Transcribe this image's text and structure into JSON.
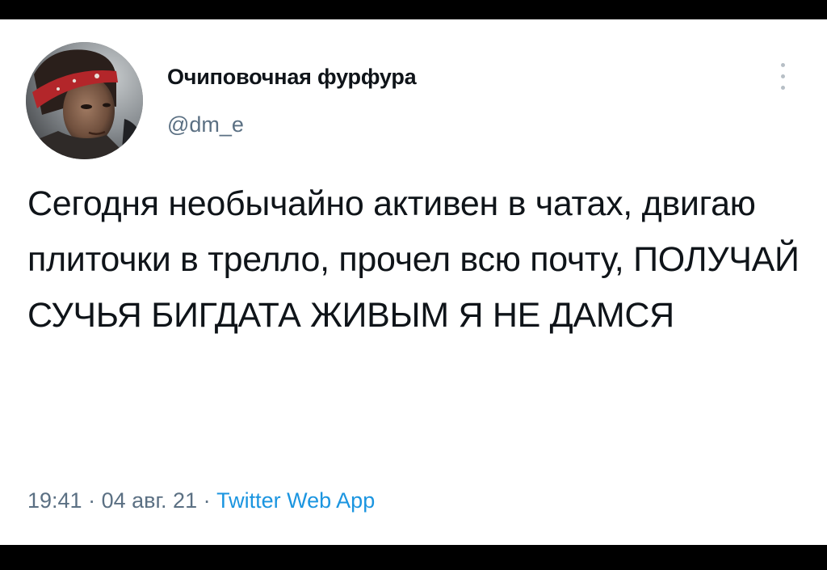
{
  "tweet": {
    "author": {
      "name": "Очиповочная фурфура",
      "handle": "@dm_e",
      "avatar_icon": "avatar-photo-woman-red-headband"
    },
    "more_icon": "vertical-ellipsis-icon",
    "text": "Сегодня необычайно активен в чатах, двигаю плиточки в трелло, прочел всю почту, ПОЛУЧАЙ СУЧЬЯ БИГДАТА ЖИВЫМ Я НЕ ДАМСЯ",
    "time": "19:41",
    "separator": "·",
    "date": "04 авг. 21",
    "source": "Twitter Web App"
  },
  "colors": {
    "background": "#ffffff",
    "frame": "#000000",
    "text_primary": "#0f1419",
    "text_secondary": "#5b7083",
    "link": "#1b95e0"
  }
}
